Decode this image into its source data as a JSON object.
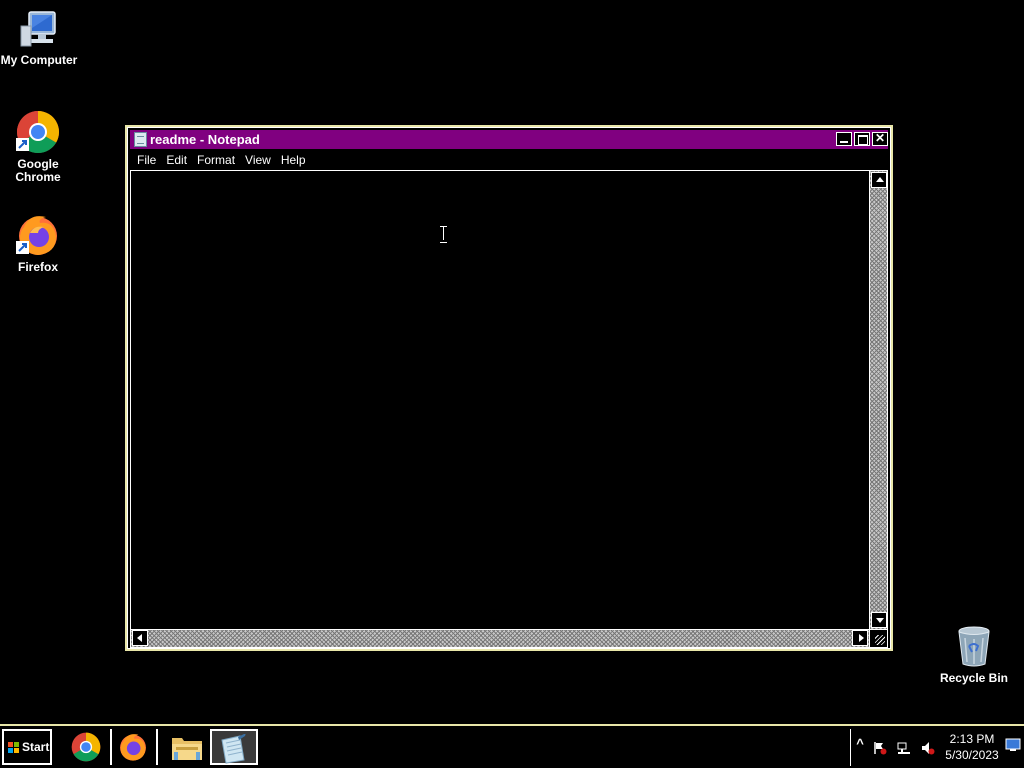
{
  "desktop": {
    "icons": [
      {
        "label": "My Computer"
      },
      {
        "label": "Google Chrome"
      },
      {
        "label": "Firefox"
      },
      {
        "label": "Recycle Bin"
      }
    ]
  },
  "notepad": {
    "title": "readme - Notepad",
    "menu": [
      "File",
      "Edit",
      "Format",
      "View",
      "Help"
    ],
    "content": ""
  },
  "taskbar": {
    "start_label": "Start",
    "apps": [
      "chrome-icon",
      "firefox-icon",
      "file-explorer-icon",
      "notepad-icon"
    ],
    "clock_time": "2:13 PM",
    "clock_date": "5/30/2023",
    "tray_expand": "^"
  },
  "colors": {
    "titlebar": "#800080",
    "window_border": "#e8e6a8",
    "desktop": "#000000"
  }
}
